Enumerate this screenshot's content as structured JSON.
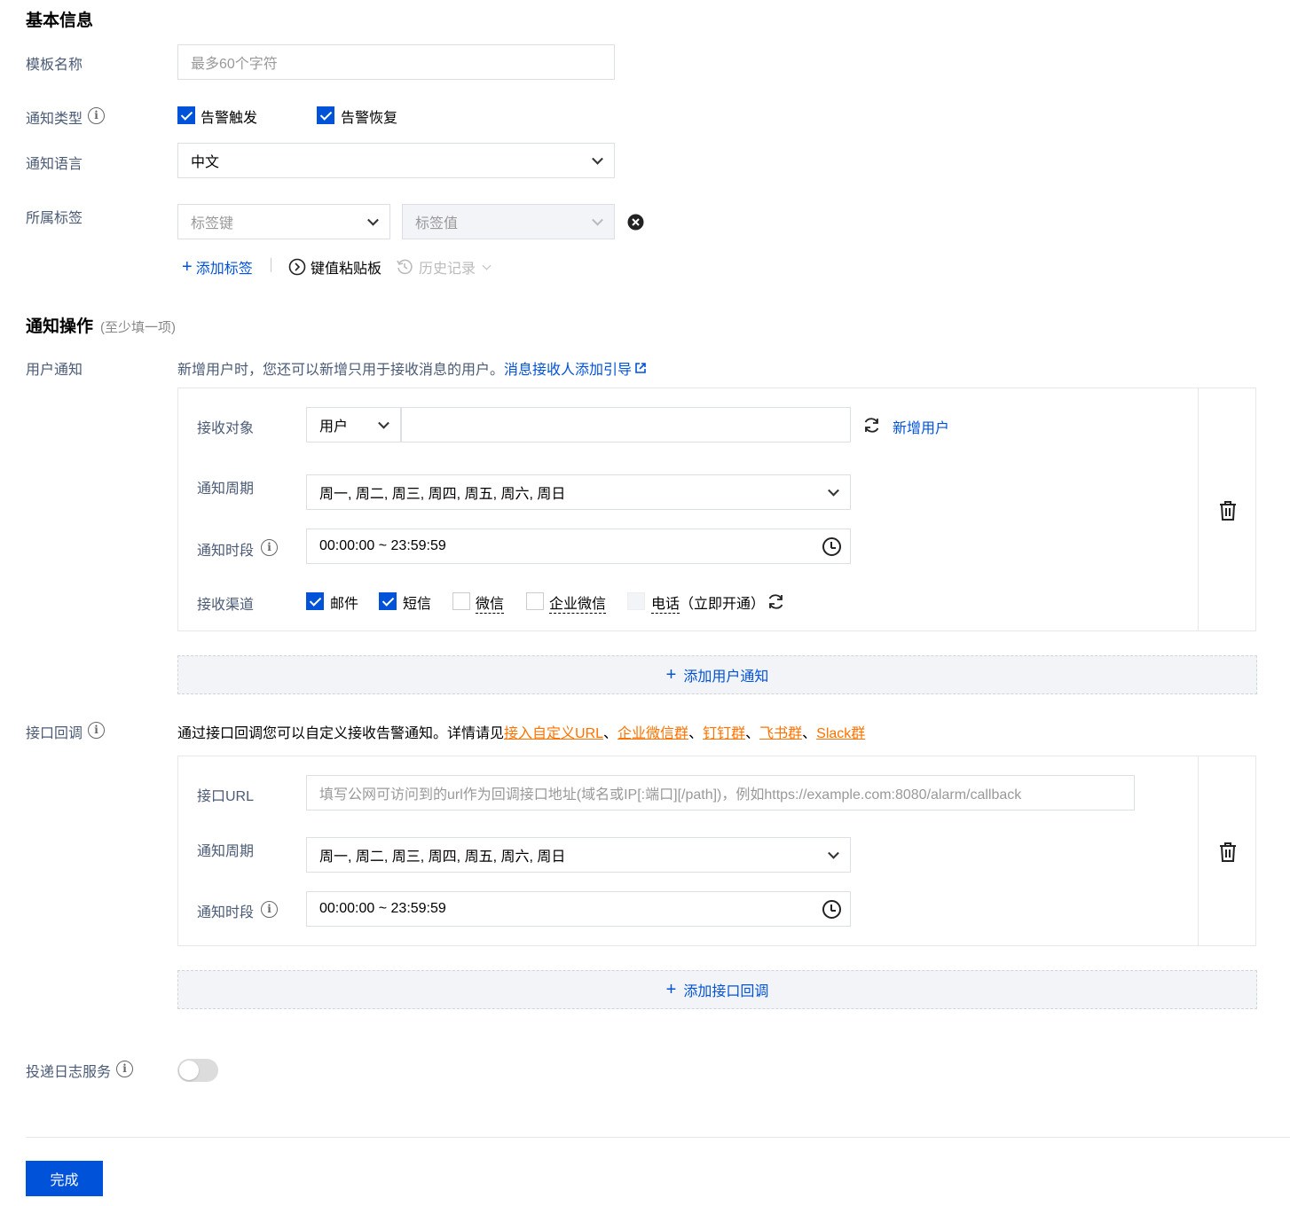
{
  "basic": {
    "title": "基本信息",
    "template_name_label": "模板名称",
    "template_name_placeholder": "最多60个字符",
    "notify_type_label": "通知类型",
    "notify_type_options": [
      "告警触发",
      "告警恢复"
    ],
    "notify_lang_label": "通知语言",
    "notify_lang_value": "中文",
    "tags_label": "所属标签",
    "tag_key_placeholder": "标签键",
    "tag_value_placeholder": "标签值",
    "add_tag": "添加标签",
    "kv_clipboard": "键值粘贴板",
    "history": "历史记录"
  },
  "actions": {
    "title": "通知操作",
    "hint": "(至少填一项)",
    "user_notify_label": "用户通知",
    "user_notify_desc": "新增用户时，您还可以新增只用于接收消息的用户。",
    "user_notify_link": "消息接收人添加引导",
    "receiver_label": "接收对象",
    "receiver_type": "用户",
    "add_user": "新增用户",
    "period_label": "通知周期",
    "period_value": "周一, 周二, 周三, 周四, 周五, 周六, 周日",
    "time_label": "通知时段",
    "time_value": "00:00:00 ~ 23:59:59",
    "channel_label": "接收渠道",
    "channels": {
      "email": "邮件",
      "sms": "短信",
      "wechat": "微信",
      "wecom": "企业微信",
      "phone": "电话",
      "phone_suffix": "（立即开通）"
    },
    "add_user_notify": "添加用户通知",
    "callback_label": "接口回调",
    "callback_desc": "通过接口回调您可以自定义接收告警通知。详情请见",
    "callback_links": [
      "接入自定义URL",
      "企业微信群",
      "钉钉群",
      "飞书群",
      "Slack群"
    ],
    "sep": "、",
    "url_label": "接口URL",
    "url_placeholder": "填写公网可访问到的url作为回调接口地址(域名或IP[:端口][/path])，例如https://example.com:8080/alarm/callback",
    "add_callback": "添加接口回调",
    "log_label": "投递日志服务",
    "log_enabled": false
  },
  "footer": {
    "submit": "完成"
  },
  "colors": {
    "primary": "#0052d9",
    "link_orange": "#ff7200",
    "label": "#4b5b76"
  }
}
